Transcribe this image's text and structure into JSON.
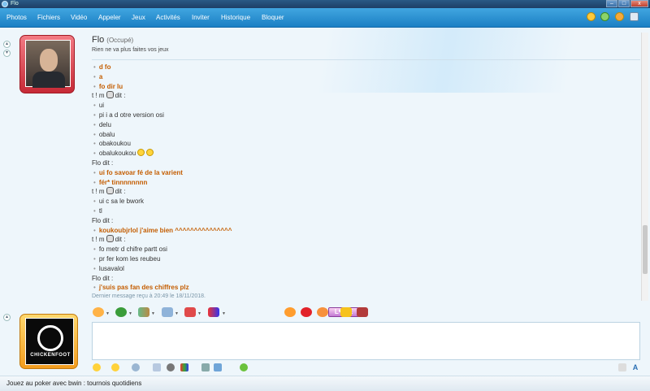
{
  "window": {
    "title": "Flo"
  },
  "menu": {
    "items": [
      "Photos",
      "Fichiers",
      "Vidéo",
      "Appeler",
      "Jeux",
      "Activités",
      "Inviter",
      "Historique",
      "Bloquer"
    ]
  },
  "contact": {
    "name": "Flo",
    "status": "(Occupé)",
    "message": "Rien ne va plus faites vos jeux"
  },
  "conversation": [
    {
      "type": "msg",
      "text": "d fo",
      "bold": true
    },
    {
      "type": "msg",
      "text": "a",
      "bold": true
    },
    {
      "type": "msg",
      "text": "fo dir lu",
      "bold": true
    },
    {
      "type": "sender",
      "name": "t ! m",
      "says": "dit :",
      "icon": "cat-emoticon"
    },
    {
      "type": "msg",
      "text": "ui",
      "bold": false
    },
    {
      "type": "msg",
      "text": "pi i a d otre version osi",
      "bold": false
    },
    {
      "type": "msg",
      "text": "delu",
      "bold": false
    },
    {
      "type": "msg",
      "text": "obalu",
      "bold": false
    },
    {
      "type": "msg",
      "text": "obakoukou",
      "bold": false
    },
    {
      "type": "msg",
      "text": "obalukoukou",
      "bold": false,
      "emoticon": "grin-emoticon"
    },
    {
      "type": "sender",
      "name": "Flo",
      "says": "dit :"
    },
    {
      "type": "msg",
      "text": "ui fo savoar fé de la varient",
      "bold": true
    },
    {
      "type": "msg",
      "text": "fér* tinnnnnnnn",
      "bold": true
    },
    {
      "type": "sender",
      "name": "t ! m",
      "says": "dit :",
      "icon": "cat-emoticon"
    },
    {
      "type": "msg",
      "text": "ui c sa le bwork",
      "bold": false
    },
    {
      "type": "msg",
      "text": "tl",
      "bold": false
    },
    {
      "type": "sender",
      "name": "Flo",
      "says": "dit :"
    },
    {
      "type": "msg",
      "text": "koukoubjrlol j'aime bien ^^^^^^^^^^^^^^^",
      "bold": true
    },
    {
      "type": "sender",
      "name": "t ! m",
      "says": "dit :",
      "icon": "cat-emoticon"
    },
    {
      "type": "msg",
      "text": "fo metr d chifre partt osi",
      "bold": false
    },
    {
      "type": "msg",
      "text": "pr fer kom les reubeu",
      "bold": false
    },
    {
      "type": "msg",
      "text": "lusavalol",
      "bold": false
    },
    {
      "type": "sender",
      "name": "Flo",
      "says": "dit :"
    },
    {
      "type": "msg",
      "text": "j'suis pas fan des chiffres plz",
      "bold": true
    }
  ],
  "last_message": "Dernier message reçu à 20:49 le 18/11/2018.",
  "toolbar": {
    "love_label": "L❤VE"
  },
  "avatar_self": {
    "caption": "CHICKENFOOT"
  },
  "statusbar": {
    "ad_text": "Jouez au poker avec bwin : tournois quotidiens"
  },
  "colors": {
    "menubar": "#1b7fc4",
    "bold_text": "#c45d00",
    "avatar_contact_frame": "#c62a36",
    "avatar_self_frame": "#f29c1e"
  }
}
